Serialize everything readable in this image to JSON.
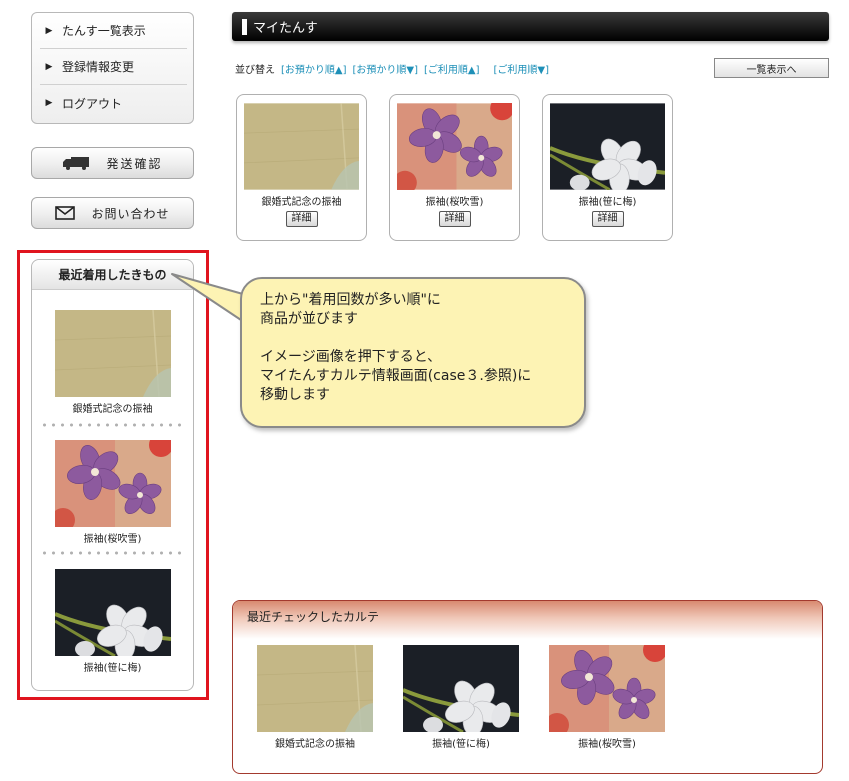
{
  "sidebar": {
    "menu": [
      {
        "label": "たんす一覧表示"
      },
      {
        "label": "登録情報変更"
      },
      {
        "label": "ログアウト"
      }
    ],
    "shipping_label": "発送確認",
    "contact_label": "お問い合わせ",
    "recent_worn": {
      "title": "最近着用したきもの",
      "items": [
        {
          "caption": "銀婚式記念の振袖",
          "image": "beige-fabric"
        },
        {
          "caption": "振袖(桜吹雪)",
          "image": "pink-purple-floral"
        },
        {
          "caption": "振袖(笹に梅)",
          "image": "black-white-floral"
        }
      ]
    }
  },
  "callout": {
    "line1": "上から\"着用回数が多い順\"に",
    "line2": "商品が並びます",
    "line3": "イメージ画像を押下すると、",
    "line4": "マイたんすカルテ情報画面(case３.参照)に",
    "line5": "移動します"
  },
  "main": {
    "title": "マイたんす",
    "sort": {
      "label": "並び替え",
      "options": [
        "[お預かり順▲]",
        "[お預かり順▼]",
        "[ご利用順▲]",
        "[ご利用順▼]"
      ]
    },
    "list_button": "一覧表示へ",
    "cards": [
      {
        "caption": "銀婚式記念の振袖",
        "detail": "詳細",
        "image": "beige-fabric"
      },
      {
        "caption": "振袖(桜吹雪)",
        "detail": "詳細",
        "image": "pink-purple-floral"
      },
      {
        "caption": "振袖(笹に梅)",
        "detail": "詳細",
        "image": "black-white-floral"
      }
    ],
    "karte": {
      "title": "最近チェックしたカルテ",
      "items": [
        {
          "caption": "銀婚式記念の振袖",
          "image": "beige-fabric"
        },
        {
          "caption": "振袖(笹に梅)",
          "image": "black-white-floral"
        },
        {
          "caption": "振袖(桜吹雪)",
          "image": "pink-purple-floral"
        }
      ]
    }
  },
  "colors": {
    "highlight_frame": "#e0141e",
    "link": "#1e90b8",
    "callout_fill": "#fdf3b4",
    "karte_border": "#a33a2e"
  }
}
